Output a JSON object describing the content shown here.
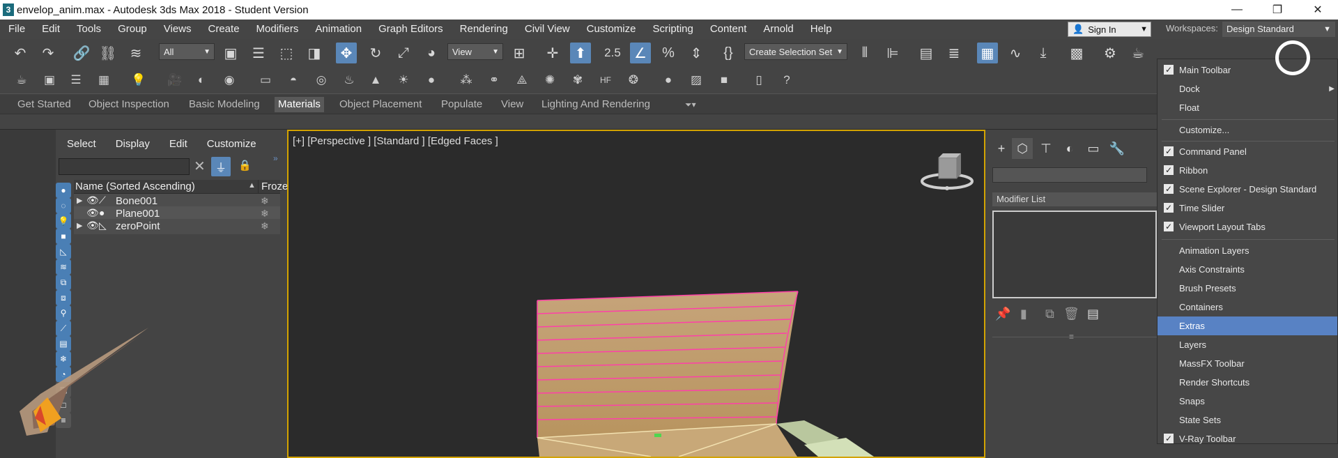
{
  "titlebar": {
    "app_icon": "3",
    "title": "envelop_anim.max - Autodesk 3ds Max 2018 - Student Version",
    "minimize": "—",
    "restore": "❐",
    "close": "✕"
  },
  "menubar": {
    "items": [
      "File",
      "Edit",
      "Tools",
      "Group",
      "Views",
      "Create",
      "Modifiers",
      "Animation",
      "Graph Editors",
      "Rendering",
      "Civil View",
      "Customize",
      "Scripting",
      "Content",
      "Arnold",
      "Help"
    ],
    "signin": "Sign In",
    "workspaces_label": "Workspaces:",
    "workspace_value": "Design Standard"
  },
  "toolbar": {
    "selection_filter": "All",
    "ref_coord": "View",
    "named_selection": "Create Selection Set",
    "snap_value": "2.5"
  },
  "ribbon": {
    "tabs": [
      "Get Started",
      "Object Inspection",
      "Basic Modeling",
      "Materials",
      "Object Placement",
      "Populate",
      "View",
      "Lighting And Rendering"
    ],
    "active": "Materials"
  },
  "explorer": {
    "menu": [
      "Select",
      "Display",
      "Edit",
      "Customize"
    ],
    "col_name": "Name (Sorted Ascending)",
    "col_frozen": "Frozen",
    "rows": [
      {
        "name": "Bone001"
      },
      {
        "name": "Plane001"
      },
      {
        "name": "zeroPoint"
      }
    ]
  },
  "viewport": {
    "label": "[+] [Perspective ] [Standard ] [Edged Faces ]"
  },
  "command_panel": {
    "modifier_list": "Modifier List"
  },
  "context_menu": {
    "items": [
      {
        "label": "Main Toolbar",
        "checked": true
      },
      {
        "label": "Dock",
        "checked": false,
        "submenu": true
      },
      {
        "label": "Float",
        "checked": false
      },
      {
        "label": "Customize...",
        "checked": false
      },
      {
        "label": "Command Panel",
        "checked": true
      },
      {
        "label": "Ribbon",
        "checked": true
      },
      {
        "label": "Scene Explorer - Design Standard",
        "checked": true
      },
      {
        "label": "Time Slider",
        "checked": true
      },
      {
        "label": "Viewport Layout Tabs",
        "checked": true
      },
      {
        "label": "Animation Layers",
        "checked": false
      },
      {
        "label": "Axis Constraints",
        "checked": false
      },
      {
        "label": "Brush Presets",
        "checked": false
      },
      {
        "label": "Containers",
        "checked": false
      },
      {
        "label": "Extras",
        "checked": false,
        "highlighted": true
      },
      {
        "label": "Layers",
        "checked": false
      },
      {
        "label": "MassFX Toolbar",
        "checked": false
      },
      {
        "label": "Render Shortcuts",
        "checked": false
      },
      {
        "label": "Snaps",
        "checked": false
      },
      {
        "label": "State Sets",
        "checked": false
      },
      {
        "label": "V-Ray Toolbar",
        "checked": true
      }
    ]
  },
  "colors": {
    "accent_blue": "#5a87b8",
    "menu_highlight": "#5882c4",
    "viewport_border": "#d3a300",
    "mesh_edge": "#ff3fa8"
  }
}
